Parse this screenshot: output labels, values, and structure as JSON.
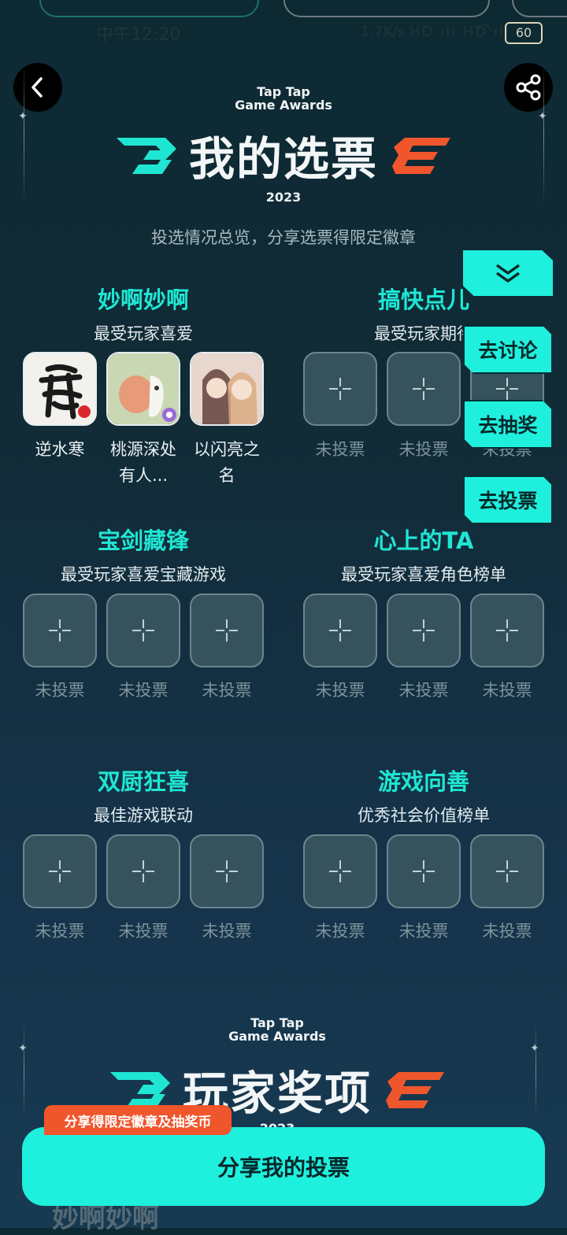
{
  "status_bar": {
    "time": "中午12:20",
    "network_speed": "1.7K/s",
    "signal": "HD ıll HD ıll",
    "battery": "60"
  },
  "header": {
    "brand_line1": "Tap Tap",
    "brand_line2": "Game Awards",
    "title": "我的选票",
    "year": "2023",
    "subtitle": "投选情况总览，分享选票得限定徽章"
  },
  "floating": {
    "discuss": "去讨论",
    "lottery": "去抽奖",
    "vote": "去投票"
  },
  "empty_label": "未投票",
  "categories": [
    {
      "title": "妙啊妙啊",
      "subtitle": "最受玩家喜爱",
      "slots": [
        {
          "label_1": "逆水寒",
          "label_2": ""
        },
        {
          "label_1": "桃源深处",
          "label_2": "有人..."
        },
        {
          "label_1": "以闪亮之",
          "label_2": "名"
        }
      ]
    },
    {
      "title": "搞快点儿",
      "subtitle": "最受玩家期待"
    },
    {
      "title": "宝剑藏锋",
      "subtitle": "最受玩家喜爱宝藏游戏"
    },
    {
      "title": "心上的TA",
      "subtitle": "最受玩家喜爱角色榜单"
    },
    {
      "title": "双厨狂喜",
      "subtitle": "最佳游戏联动"
    },
    {
      "title": "游戏向善",
      "subtitle": "优秀社会价值榜单"
    }
  ],
  "section2": {
    "brand_line1": "Tap Tap",
    "brand_line2": "Game Awards",
    "title": "玩家奖项",
    "year": "2023",
    "ghost_text": "妙啊妙啊"
  },
  "bottom": {
    "promo": "分享得限定徽章及抽奖币",
    "share_button": "分享我的投票"
  },
  "colors": {
    "accent": "#1ff0de",
    "category_title": "#1fe6d3",
    "orange": "#f0562c"
  }
}
